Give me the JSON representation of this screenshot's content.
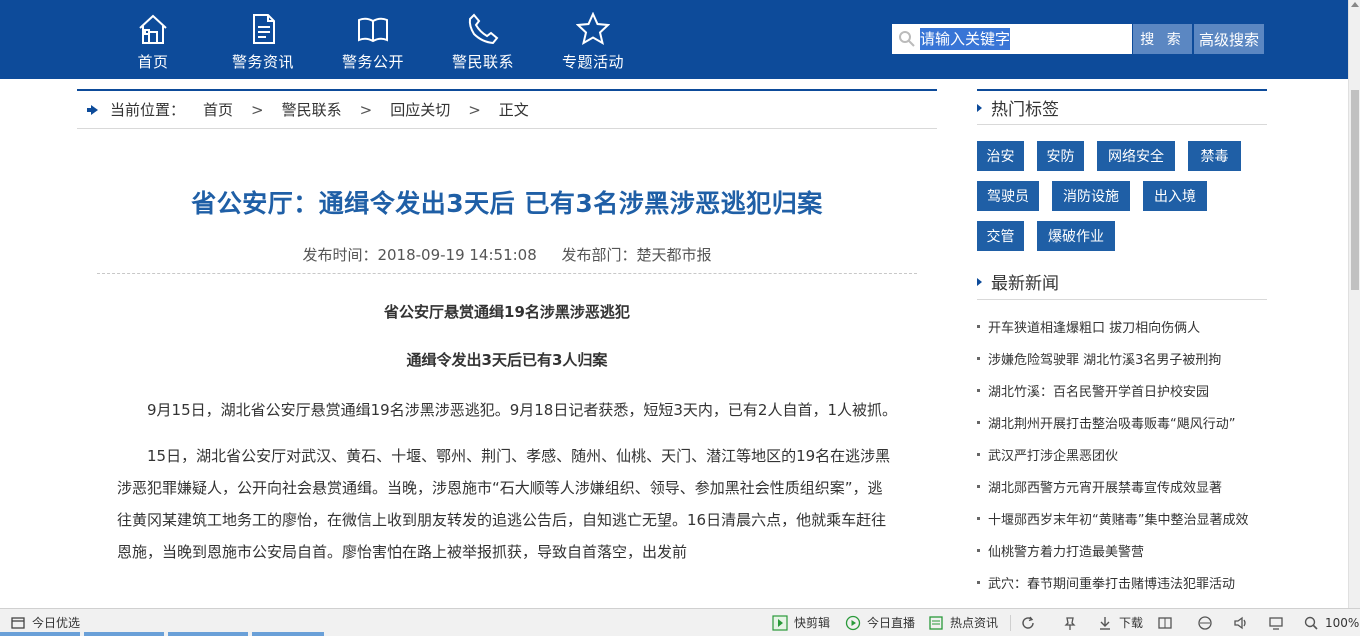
{
  "nav": [
    {
      "label": "首页",
      "icon": "home-icon"
    },
    {
      "label": "警务资讯",
      "icon": "document-icon"
    },
    {
      "label": "警务公开",
      "icon": "book-icon"
    },
    {
      "label": "警民联系",
      "icon": "phone-icon"
    },
    {
      "label": "专题活动",
      "icon": "star-icon"
    }
  ],
  "search": {
    "placeholder": "请输入关键字",
    "button": "搜 索",
    "advanced": "高级搜索"
  },
  "breadcrumb": {
    "prefix": "当前位置：",
    "items": [
      "首页",
      "警民联系",
      "回应关切",
      "正文"
    ],
    "separator": ">"
  },
  "article": {
    "title": "省公安厅：通缉令发出3天后 已有3名涉黑涉恶逃犯归案",
    "publish_time": "发布时间：2018-09-19 14:51:08",
    "department": "发布部门：楚天都市报",
    "subtitle1": "省公安厅悬赏通缉19名涉黑涉恶逃犯",
    "subtitle2": "通缉令发出3天后已有3人归案",
    "paragraphs": [
      "9月15日，湖北省公安厅悬赏通缉19名涉黑涉恶逃犯。9月18日记者获悉，短短3天内，已有2人自首，1人被抓。",
      "15日，湖北省公安厅对武汉、黄石、十堰、鄂州、荆门、孝感、随州、仙桃、天门、潜江等地区的19名在逃涉黑涉恶犯罪嫌疑人，公开向社会悬赏通缉。当晚，涉恩施市“石大顺等人涉嫌组织、领导、参加黑社会性质组织案”，逃往黄冈某建筑工地务工的廖怡，在微信上收到朋友转发的追逃公告后，自知逃亡无望。16日清晨六点，他就乘车赶往恩施，当晚到恩施市公安局自首。廖怡害怕在路上被举报抓获，导致自首落空，出发前"
    ]
  },
  "sidebar": {
    "hot_tags_title": "热门标签",
    "tags": [
      "治安",
      "安防",
      "网络安全",
      "禁毒",
      "驾驶员",
      "消防设施",
      "出入境",
      "交管",
      "爆破作业"
    ],
    "news_title": "最新新闻",
    "news": [
      "开车狭道相逢爆粗口 拔刀相向伤俩人",
      "涉嫌危险驾驶罪 湖北竹溪3名男子被刑拘",
      "湖北竹溪：百名民警开学首日护校安园",
      "湖北荆州开展打击整治吸毒贩毒“飓风行动”",
      "武汉严打涉企黑恶团伙",
      "湖北郧西警方元宵开展禁毒宣传成效显著",
      "十堰郧西岁末年初“黄赌毒”集中整治显著成效",
      "仙桃警方着力打造最美警营",
      "武穴：春节期间重拳打击赌博违法犯罪活动"
    ]
  },
  "statusbar": {
    "left": "今日优选",
    "kuaijianji": "快剪辑",
    "live": "今日直播",
    "hotnews": "热点资讯",
    "download": "下载",
    "zoom": "100%"
  },
  "colors": {
    "brand": "#0d4b9a",
    "title": "#1f5fa6",
    "tag": "#1f5fa6"
  }
}
